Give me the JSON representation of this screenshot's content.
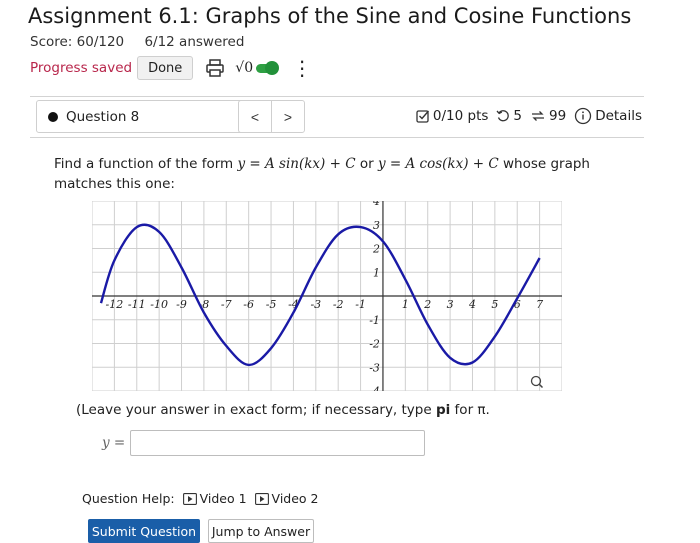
{
  "header": {
    "title": "Assignment 6.1: Graphs of the Sine and Cosine Functions",
    "score": "Score: 60/120",
    "answered": "6/12 answered",
    "progress_saved": "Progress saved",
    "done_label": "Done",
    "sqrt_label": "√0",
    "kebab": "⋮"
  },
  "question_nav": {
    "selected_question": "Question 8",
    "prev": "<",
    "next": ">",
    "points": "0/10 pts",
    "retries": "5",
    "attempts": "99",
    "details": "Details"
  },
  "prompt": {
    "text_before": "Find a function of the form ",
    "form1": "y = A sin(kx) + C",
    "or": " or ",
    "form2": "y = A cos(kx) + C",
    "text_after": " whose graph matches this one:"
  },
  "chart_data": {
    "type": "line",
    "title": "",
    "xlabel": "",
    "ylabel": "",
    "xlim": [
      -13,
      8
    ],
    "ylim": [
      -4,
      4
    ],
    "x_ticks": [
      "-12",
      "-11",
      "-10",
      "-9",
      "-8",
      "-7",
      "-6",
      "-5",
      "-4",
      "-3",
      "-2",
      "-1",
      "1",
      "2",
      "3",
      "4",
      "5",
      "6",
      "7"
    ],
    "y_ticks": [
      "4",
      "3",
      "2",
      "1",
      "-1",
      "-2",
      "-3",
      "-4"
    ],
    "grid": true,
    "line_color": "#1a1aa6",
    "x": [
      -12.6,
      -12,
      -11,
      -10,
      -9,
      -8,
      -7,
      -6,
      -5,
      -4,
      -3,
      -2,
      -1,
      0,
      1,
      2,
      3,
      4,
      5,
      6,
      7
    ],
    "y": [
      -0.3,
      1.5,
      2.9,
      2.7,
      1.2,
      -0.7,
      -2.1,
      -2.9,
      -2.2,
      -0.7,
      1.2,
      2.6,
      2.9,
      2.3,
      0.7,
      -1.2,
      -2.6,
      -2.8,
      -1.7,
      -0.1,
      1.6
    ]
  },
  "instructions": {
    "leave_before": "(Leave your answer in exact form; if necessary, type ",
    "pi_bold": "pi",
    "leave_after": " for π."
  },
  "answer": {
    "label": "y =",
    "value": ""
  },
  "help": {
    "label": "Question Help:",
    "video1": "Video 1",
    "video2": "Video 2"
  },
  "buttons": {
    "submit": "Submit Question",
    "jump": "Jump to Answer"
  }
}
